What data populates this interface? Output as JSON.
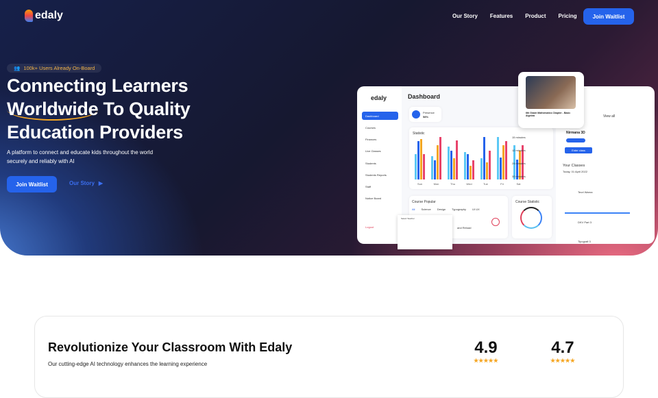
{
  "brand": "edaly",
  "nav": {
    "items": [
      "Our Story",
      "Features",
      "Product",
      "Pricing"
    ],
    "cta": "Join Waitlist"
  },
  "hero": {
    "badge": "100k+ Users Already On-Board",
    "title_1": "Connecting Learners",
    "title_2a": "Worldwide",
    "title_2b": " To Quality",
    "title_3": "Education Providers",
    "subtitle": "A platform to connect and educate kids throughout the world securely and reliably with AI",
    "join": "Join Waitlist",
    "story": "Our Story",
    "story_arrow": "▶"
  },
  "dashboard": {
    "title": "Dashboard",
    "sidebar": [
      "Dashboard",
      "Courses",
      "Finances",
      "Live Classes",
      "Students",
      "Students Reports",
      "Staff",
      "Notice Board"
    ],
    "logout": "Logout",
    "presence_label": "Presence",
    "presence_value": "58%",
    "statistic": "Statistic",
    "days": [
      "Sun",
      "Mon",
      "Thu",
      "Wed",
      "Tue",
      "Fri",
      "Sat"
    ],
    "minutes": [
      "15 minutes",
      "12 minutes",
      "24 minutes",
      "32 minutes"
    ],
    "course_popular": "Course Popular",
    "course_tabs": [
      "All",
      "Science",
      "Design",
      "Typography",
      "UI UX"
    ],
    "course_statistic": "Course Statistic",
    "view_all": "View all",
    "course_name": "Nirmana 3D",
    "enter_class": "Enter class",
    "your_classes": "Your Classes",
    "date": "Today, 01 April 2022",
    "classes": [
      "Teori Warna",
      "DKV Part 3",
      "Tipografi 3"
    ],
    "video_title": "6th Grade Mathematics Chapter - Basic Algebra",
    "dropdown": "Select Teacher",
    "reload": "and Reload"
  },
  "section": {
    "title": "Revolutionize Your Classroom With Edaly",
    "text": "Our cutting-edge AI technology enhances the learning experience",
    "ratings": [
      "4.9",
      "4.7"
    ],
    "stars": "★★★★★"
  },
  "colors": {
    "accent": "#2563eb",
    "badge": "#f5b547"
  }
}
